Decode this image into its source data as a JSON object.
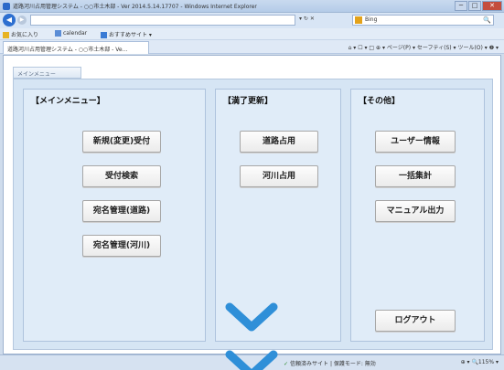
{
  "window": {
    "title": "道路河川占用管理システム - ○○市土木部 - Ver 2014.5.14.17707 - Windows Internet Explorer",
    "controls": [
      "─",
      "□",
      "✕"
    ]
  },
  "address_bar": {
    "url": "",
    "tools": "▾ ↻ ✕",
    "search_label": "Bing",
    "search_icon": "🔍"
  },
  "favorites": {
    "items": [
      "お気に入り",
      "calendar",
      "おすすめサイト ▾"
    ]
  },
  "tab": {
    "label": "道路河川占用管理システム - ○○市土木部 - Ve...",
    "command_bar": "⌂ ▾ ☐ ▾ □ ⊕ ▾ ページ(P) ▾ セーフティ(S) ▾ ツール(O) ▾ ❷ ▾"
  },
  "page": {
    "menu_tab": "メインメニュー",
    "groups": [
      {
        "title": "【メインメニュー】",
        "buttons": [
          "新規(変更)受付",
          "受付検索",
          "宛名管理(道路)",
          "宛名管理(河川)"
        ]
      },
      {
        "title": "【満了更新】",
        "buttons": [
          "道路占用",
          "河川占用"
        ]
      },
      {
        "title": "【その他】",
        "buttons": [
          "ユーザー情報",
          "一括集計",
          "マニュアル出力",
          "ログアウト"
        ]
      }
    ]
  },
  "status_bar": {
    "zone": "信頼済みサイト | 保護モード: 無効",
    "zoom": "⊕ ▾ 🔍115% ▾"
  },
  "colors": {
    "panel": "#d6e5f4",
    "group": "#e0ecf8",
    "chevron": "#2f8fd8"
  }
}
